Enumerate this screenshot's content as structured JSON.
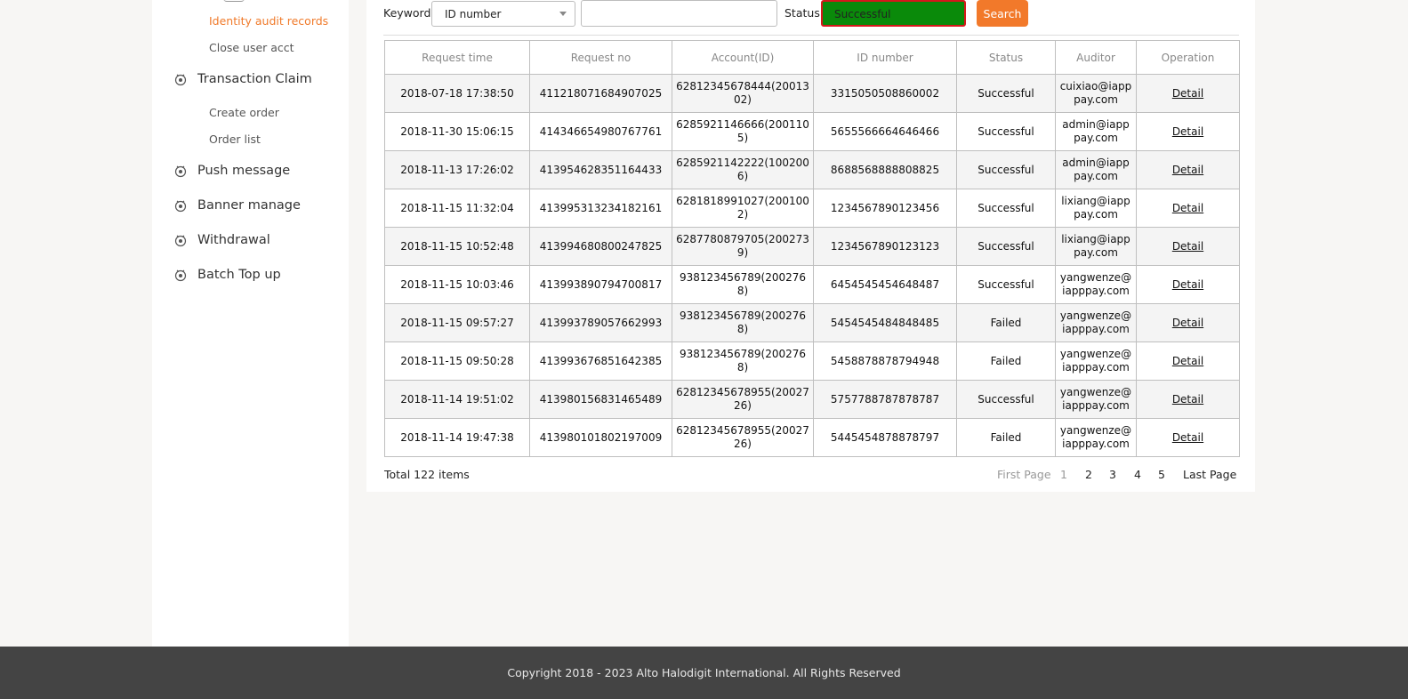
{
  "sidebar": {
    "sub_top": [
      {
        "label": "Identity audit records",
        "active": true
      },
      {
        "label": "Close user acct",
        "active": false
      }
    ],
    "groups": [
      {
        "label": "Transaction Claim",
        "icon": "gear-icon"
      },
      {
        "label": "Push message",
        "icon": "gear-icon"
      },
      {
        "label": "Banner manage",
        "icon": "gear-icon"
      },
      {
        "label": "Withdrawal",
        "icon": "gear-icon"
      },
      {
        "label": "Batch Top up",
        "icon": "gear-icon"
      }
    ],
    "claim_items": [
      {
        "label": "Create order"
      },
      {
        "label": "Order list"
      }
    ]
  },
  "filter": {
    "keyword_label": "Keyword",
    "keyword_type": "ID number",
    "keyword_value": "",
    "status_label": "Status",
    "status_value": "Successful",
    "search_label": "Search"
  },
  "table": {
    "headers": [
      "Request time",
      "Request no",
      "Account(ID)",
      "ID number",
      "Status",
      "Auditor",
      "Operation"
    ],
    "rows": [
      [
        "2018-07-18 17:38:50",
        "411218071684907025",
        "62812345678444(2001302)",
        "3315050508860002",
        "Successful",
        "cuixiao@iapppay.com",
        "Detail"
      ],
      [
        "2018-11-30 15:06:15",
        "414346654980767761",
        "6285921146666(2001105)",
        "5655566664646466",
        "Successful",
        "admin@iapppay.com",
        "Detail"
      ],
      [
        "2018-11-13 17:26:02",
        "413954628351164433",
        "6285921142222(1002006)",
        "8688568888808825",
        "Successful",
        "admin@iapppay.com",
        "Detail"
      ],
      [
        "2018-11-15 11:32:04",
        "413995313234182161",
        "6281818991027(2001002)",
        "1234567890123456",
        "Successful",
        "lixiang@iapppay.com",
        "Detail"
      ],
      [
        "2018-11-15 10:52:48",
        "413994680800247825",
        "6287780879705(2002739)",
        "1234567890123123",
        "Successful",
        "lixiang@iapppay.com",
        "Detail"
      ],
      [
        "2018-11-15 10:03:46",
        "413993890794700817",
        "938123456789(2002768)",
        "6454545454648487",
        "Successful",
        "yangwenze@iapppay.com",
        "Detail"
      ],
      [
        "2018-11-15 09:57:27",
        "413993789057662993",
        "938123456789(2002768)",
        "5454545484848485",
        "Failed",
        "yangwenze@iapppay.com",
        "Detail"
      ],
      [
        "2018-11-15 09:50:28",
        "413993676851642385",
        "938123456789(2002768)",
        "5458878878794948",
        "Failed",
        "yangwenze@iapppay.com",
        "Detail"
      ],
      [
        "2018-11-14 19:51:02",
        "413980156831465489",
        "62812345678955(2002726)",
        "5757788787878787",
        "Successful",
        "yangwenze@iapppay.com",
        "Detail"
      ],
      [
        "2018-11-14 19:47:38",
        "413980101802197009",
        "62812345678955(2002726)",
        "5445454878878797",
        "Failed",
        "yangwenze@iapppay.com",
        "Detail"
      ]
    ]
  },
  "pagination": {
    "total_label": "Total 122 items",
    "first_label": "First Page",
    "pages": [
      "1",
      "2",
      "3",
      "4",
      "5"
    ],
    "current_page": "1",
    "last_label": "Last Page"
  },
  "footer": {
    "copyright": "Copyright 2018 - 2023 Alto Halodigit International. All Rights Reserved"
  },
  "colors": {
    "accent": "#f2792a",
    "status_field_bg": "#0a8a0a",
    "status_field_border": "#d6181b",
    "footer_bg": "#444444"
  }
}
